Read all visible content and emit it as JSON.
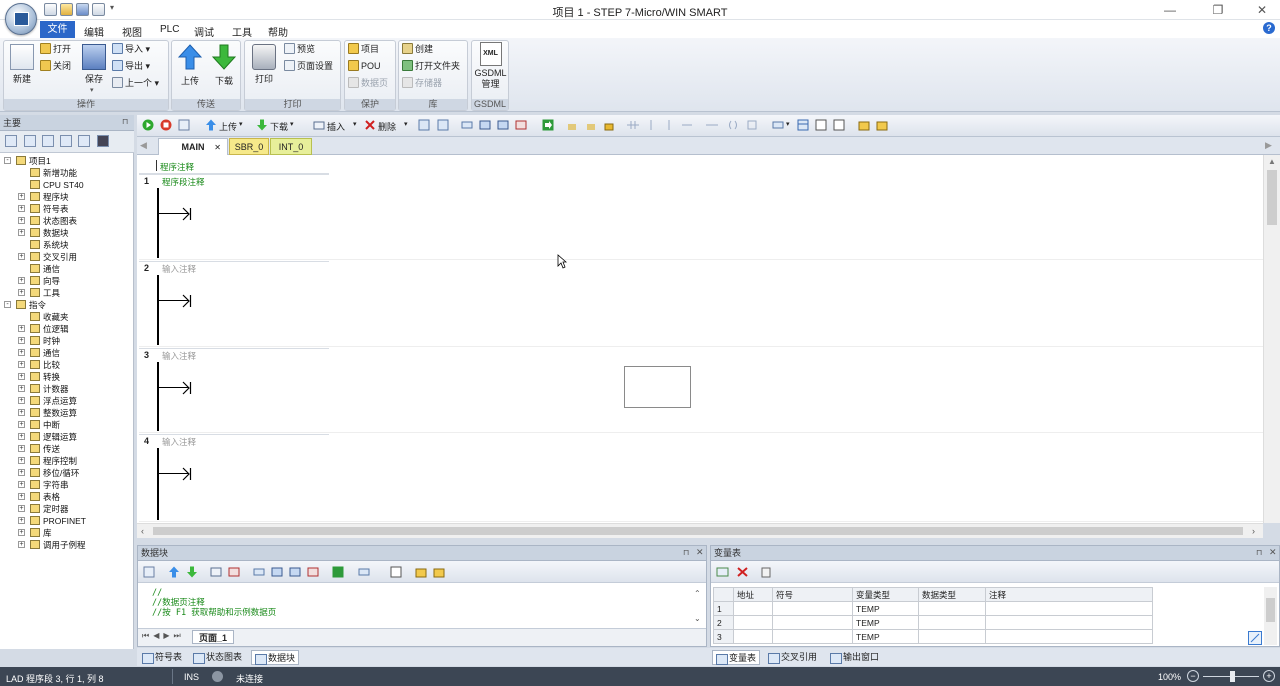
{
  "window": {
    "title": "项目 1 - STEP 7-Micro/WIN SMART",
    "minimize": "—",
    "restore": "❐",
    "close": "✕"
  },
  "menu": {
    "items": [
      "文件",
      "编辑",
      "视图",
      "PLC",
      "调试",
      "工具",
      "帮助"
    ],
    "help": "?"
  },
  "ribbon": {
    "groups": [
      {
        "label": "操作",
        "big": [
          "新建",
          "保存"
        ],
        "small": [
          "打开",
          "关闭",
          "导入",
          "导出",
          "上一个"
        ]
      },
      {
        "label": "传送",
        "big": [
          "上传",
          "下载"
        ]
      },
      {
        "label": "打印",
        "big": [
          "打印"
        ],
        "small": [
          "预览",
          "页面设置"
        ]
      },
      {
        "label": "保护",
        "small": [
          "项目",
          "POU",
          "数据页"
        ]
      },
      {
        "label": "库",
        "small": [
          "创建",
          "打开文件夹",
          "存储器"
        ]
      },
      {
        "label": "GSDML",
        "big": [
          "GSDML\n管理"
        ],
        "xml": "XML"
      }
    ]
  },
  "left_panel": {
    "title": "主要",
    "pin": "⊓"
  },
  "tree": [
    {
      "label": "项目1",
      "level": 0,
      "exp": "-"
    },
    {
      "label": "新增功能",
      "level": 1
    },
    {
      "label": "CPU ST40",
      "level": 1
    },
    {
      "label": "程序块",
      "level": 1,
      "exp": "+"
    },
    {
      "label": "符号表",
      "level": 1,
      "exp": "+"
    },
    {
      "label": "状态图表",
      "level": 1,
      "exp": "+"
    },
    {
      "label": "数据块",
      "level": 1,
      "exp": "+"
    },
    {
      "label": "系统块",
      "level": 1
    },
    {
      "label": "交叉引用",
      "level": 1,
      "exp": "+"
    },
    {
      "label": "通信",
      "level": 1
    },
    {
      "label": "向导",
      "level": 1,
      "exp": "+"
    },
    {
      "label": "工具",
      "level": 1,
      "exp": "+"
    },
    {
      "label": "指令",
      "level": 0,
      "exp": "-"
    },
    {
      "label": "收藏夹",
      "level": 1
    },
    {
      "label": "位逻辑",
      "level": 1,
      "exp": "+"
    },
    {
      "label": "时钟",
      "level": 1,
      "exp": "+"
    },
    {
      "label": "通信",
      "level": 1,
      "exp": "+"
    },
    {
      "label": "比较",
      "level": 1,
      "exp": "+"
    },
    {
      "label": "转换",
      "level": 1,
      "exp": "+"
    },
    {
      "label": "计数器",
      "level": 1,
      "exp": "+"
    },
    {
      "label": "浮点运算",
      "level": 1,
      "exp": "+"
    },
    {
      "label": "整数运算",
      "level": 1,
      "exp": "+"
    },
    {
      "label": "中断",
      "level": 1,
      "exp": "+"
    },
    {
      "label": "逻辑运算",
      "level": 1,
      "exp": "+"
    },
    {
      "label": "传送",
      "level": 1,
      "exp": "+"
    },
    {
      "label": "程序控制",
      "level": 1,
      "exp": "+"
    },
    {
      "label": "移位/循环",
      "level": 1,
      "exp": "+"
    },
    {
      "label": "字符串",
      "level": 1,
      "exp": "+"
    },
    {
      "label": "表格",
      "level": 1,
      "exp": "+"
    },
    {
      "label": "定时器",
      "level": 1,
      "exp": "+"
    },
    {
      "label": "PROFINET",
      "level": 1,
      "exp": "+"
    },
    {
      "label": "库",
      "level": 1,
      "exp": "+"
    },
    {
      "label": "调用子例程",
      "level": 1,
      "exp": "+"
    }
  ],
  "editor_toolbar": {
    "upload": "上传",
    "download": "下载",
    "insert": "插入",
    "delete": "删除"
  },
  "tabs": [
    {
      "label": "MAIN",
      "close": "✕"
    },
    {
      "label": "SBR_0"
    },
    {
      "label": "INT_0"
    }
  ],
  "editor": {
    "program_comment": "程序注释",
    "networks": [
      {
        "num": "1",
        "comment": "程序段注释"
      },
      {
        "num": "2",
        "comment": "输入注释"
      },
      {
        "num": "3",
        "comment": "输入注释"
      },
      {
        "num": "4",
        "comment": "输入注释"
      }
    ]
  },
  "data_block": {
    "title": "数据块",
    "code": [
      "//",
      "//数据页注释",
      "//按 F1 获取帮助和示例数据页"
    ],
    "page_tab": "页面_1"
  },
  "var_table": {
    "title": "变量表",
    "headers": [
      "",
      "地址",
      "符号",
      "变量类型",
      "数据类型",
      "注释"
    ],
    "rows": [
      [
        "1",
        "",
        "",
        "TEMP",
        "",
        ""
      ],
      [
        "2",
        "",
        "",
        "TEMP",
        "",
        ""
      ],
      [
        "3",
        "",
        "",
        "TEMP",
        "",
        ""
      ]
    ]
  },
  "bottom_tabs_left": [
    "符号表",
    "状态图表",
    "数据块"
  ],
  "bottom_tabs_right": [
    "变量表",
    "交叉引用",
    "输出窗口"
  ],
  "status": {
    "position": "LAD 程序段 3, 行 1, 列 8",
    "mode": "INS",
    "connection": "未连接",
    "zoom": "100%"
  }
}
